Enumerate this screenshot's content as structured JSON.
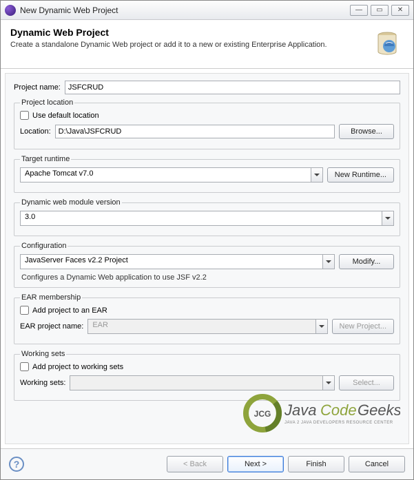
{
  "window": {
    "title": "New Dynamic Web Project"
  },
  "banner": {
    "heading": "Dynamic Web Project",
    "subheading": "Create a standalone Dynamic Web project or add it to a new or existing Enterprise Application."
  },
  "project_name": {
    "label": "Project name:",
    "value": "JSFCRUD"
  },
  "project_location": {
    "legend": "Project location",
    "use_default_label": "Use default location",
    "use_default_checked": false,
    "location_label": "Location:",
    "location_value": "D:\\Java\\JSFCRUD",
    "browse_label": "Browse..."
  },
  "target_runtime": {
    "legend": "Target runtime",
    "value": "Apache Tomcat v7.0",
    "new_runtime_label": "New Runtime..."
  },
  "module_version": {
    "legend": "Dynamic web module version",
    "value": "3.0"
  },
  "configuration": {
    "legend": "Configuration",
    "value": "JavaServer Faces v2.2 Project",
    "modify_label": "Modify...",
    "description": "Configures a Dynamic Web application to use JSF v2.2"
  },
  "ear": {
    "legend": "EAR membership",
    "add_label": "Add project to an EAR",
    "add_checked": false,
    "name_label": "EAR project name:",
    "name_value": "EAR",
    "new_project_label": "New Project..."
  },
  "working_sets": {
    "legend": "Working sets",
    "add_label": "Add project to working sets",
    "add_checked": false,
    "ws_label": "Working sets:",
    "ws_value": "",
    "select_label": "Select..."
  },
  "footer": {
    "back": "< Back",
    "next": "Next >",
    "finish": "Finish",
    "cancel": "Cancel"
  },
  "watermark": {
    "line1": "Java Code Geeks",
    "line2": "JAVA 2 JAVA DEVELOPERS RESOURCE CENTER",
    "badge": "JCG"
  }
}
